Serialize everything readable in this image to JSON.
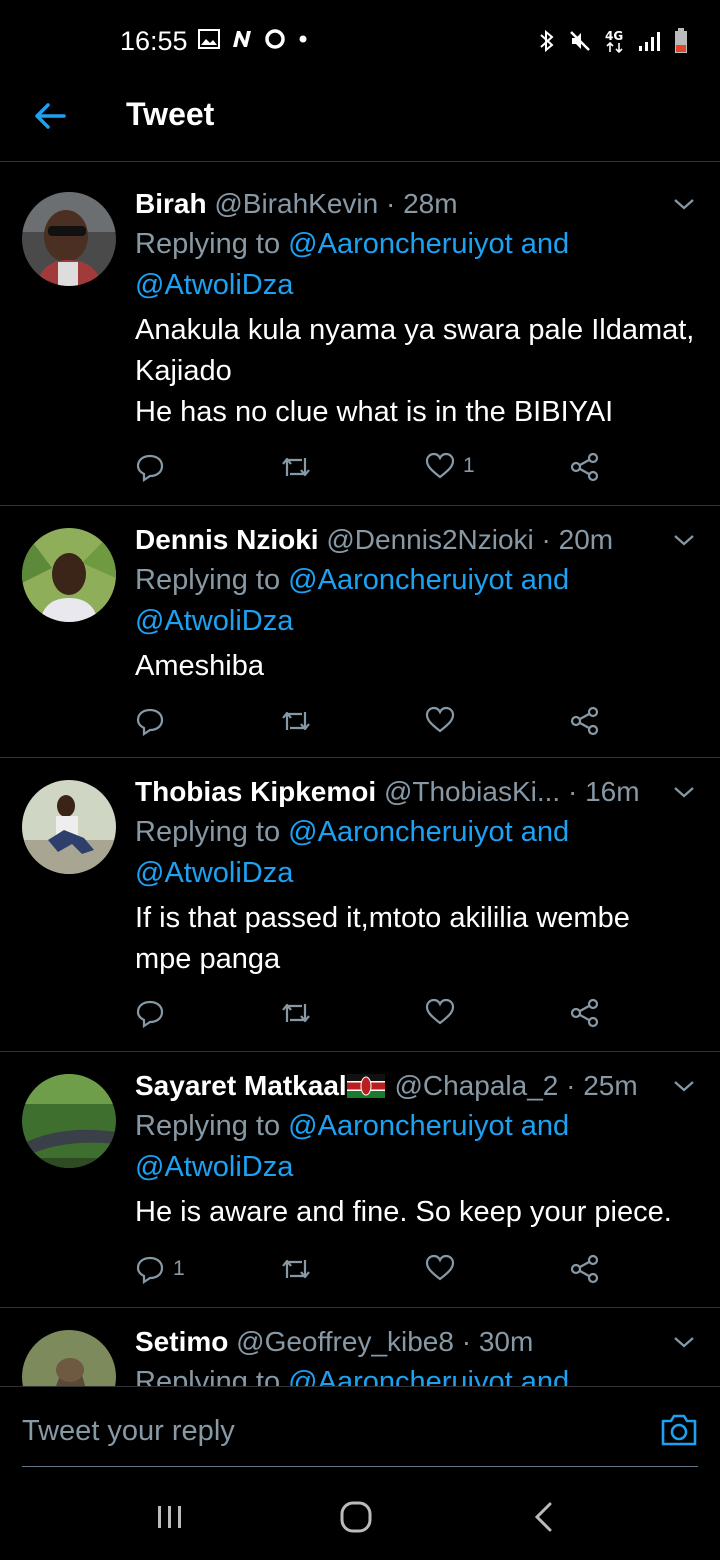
{
  "status_bar": {
    "time": "16:55",
    "left_icons": [
      "gallery-icon",
      "n-icon",
      "o-icon",
      "dot-icon"
    ],
    "right_icons": [
      "bluetooth-icon",
      "mute-icon",
      "4g-icon",
      "signal-icon",
      "battery-icon"
    ]
  },
  "header": {
    "title": "Tweet"
  },
  "replying_prefix": "Replying to ",
  "tweets": [
    {
      "name": "Birah",
      "handle": "@BirahKevin",
      "time": "· 28m",
      "reply_to_1": "@Aaroncheruiyot and",
      "reply_to_2": "@AtwoliDza",
      "text": [
        "Anakula kula nyama ya swara pale Ildamat,",
        "Kajiado",
        "He has no clue what is in the BIBIYAI"
      ],
      "reply_count": "",
      "retweet_count": "",
      "like_count": "1"
    },
    {
      "name": "Dennis Nzioki",
      "handle": "@Dennis2Nzioki",
      "time": "· 20m",
      "reply_to_1": "@Aaroncheruiyot and",
      "reply_to_2": "@AtwoliDza",
      "text": [
        "Ameshiba"
      ],
      "reply_count": "",
      "retweet_count": "",
      "like_count": ""
    },
    {
      "name": "Thobias Kipkemoi",
      "handle": "@ThobiasKi...",
      "time": "· 16m",
      "reply_to_1": "@Aaroncheruiyot and",
      "reply_to_2": "@AtwoliDza",
      "text": [
        "If is that passed it,mtoto akililia wembe",
        "mpe panga"
      ],
      "reply_count": "",
      "retweet_count": "",
      "like_count": ""
    },
    {
      "name": "Sayaret Matkaal",
      "handle": "@Chapala_2",
      "time": "· 25m",
      "reply_to_1": "@Aaroncheruiyot and",
      "reply_to_2": "@AtwoliDza",
      "text": [
        "He is aware and fine. So keep your piece."
      ],
      "reply_count": "1",
      "retweet_count": "",
      "like_count": ""
    },
    {
      "name": "Setimo",
      "handle": "@Geoffrey_kibe8",
      "time": "· 30m",
      "reply_to_1": "@Aaroncheruiyot and",
      "reply_to_2": "",
      "text": [],
      "reply_count": "",
      "retweet_count": "",
      "like_count": ""
    }
  ],
  "composer": {
    "placeholder": "Tweet your reply"
  },
  "colors": {
    "accent": "#1da1f2",
    "muted": "#8899a6",
    "divider": "#2f3336",
    "background": "#000000"
  }
}
